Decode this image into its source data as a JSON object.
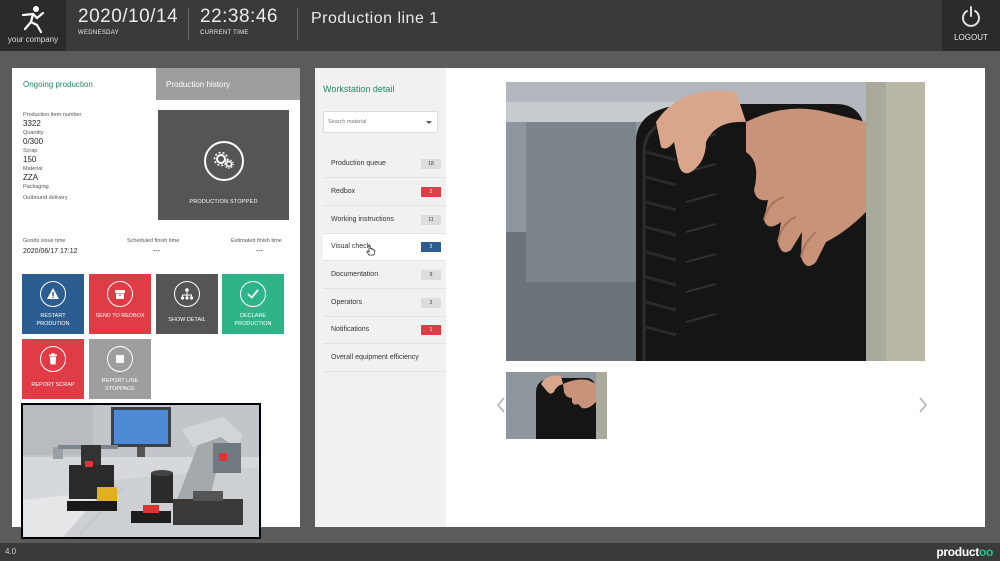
{
  "header": {
    "logo_text": "your company",
    "date": "2020/10/14",
    "weekday": "WEDNESDAY",
    "time": "22:38:46",
    "time_label": "CURRENT TIME",
    "title": "Production line 1",
    "logout_label": "LOGOUT"
  },
  "tabs": {
    "ongoing": "Ongoing production",
    "history": "Production history"
  },
  "production": {
    "item_number_label": "Production item number",
    "item_number": "3322",
    "quantity_label": "Quantity",
    "quantity": "0/300",
    "scrap_label": "Scrap",
    "scrap": "150",
    "material_label": "Material",
    "material": "ZZA",
    "packaging_label": "Packaging",
    "outbound_label": "Outbound delivery",
    "status": "PRODUCTION STOPPED"
  },
  "times": {
    "goods_issue_label": "Goods issue time",
    "goods_issue": "2020/06/17 17:12",
    "scheduled_label": "Scheduled finish time",
    "scheduled": "---",
    "estimated_label": "Estimated finish time",
    "estimated": "---"
  },
  "actions": {
    "restart": "RESTART PRODUTION",
    "redbox": "SEND TO REDBOX",
    "detail": "SHOW DETAIL",
    "declare": "DECLARE PRODUCTION",
    "scrap": "REPORT SCRAP",
    "stoppage": "REPORT LINE STOPPAGE"
  },
  "workstation": {
    "title": "Workstation detail",
    "search_placeholder": "Search material",
    "items": [
      {
        "label": "Production queue",
        "badge": "18"
      },
      {
        "label": "Redbox",
        "badge": "2"
      },
      {
        "label": "Working instructions",
        "badge": "11"
      },
      {
        "label": "Visual check",
        "badge": "2"
      },
      {
        "label": "Documentation",
        "badge": "9"
      },
      {
        "label": "Operators",
        "badge": "2"
      },
      {
        "label": "Notifications",
        "badge": "1"
      },
      {
        "label": "Overall equipment efficiency",
        "badge": ""
      }
    ]
  },
  "footer": {
    "version": "4.0",
    "brand_main": "product",
    "brand_accent": "oo"
  },
  "colors": {
    "accent_green": "#1f8a68",
    "blue": "#2c5d91",
    "red": "#e03c45",
    "gray": "#555555",
    "teal": "#2fb48a"
  }
}
